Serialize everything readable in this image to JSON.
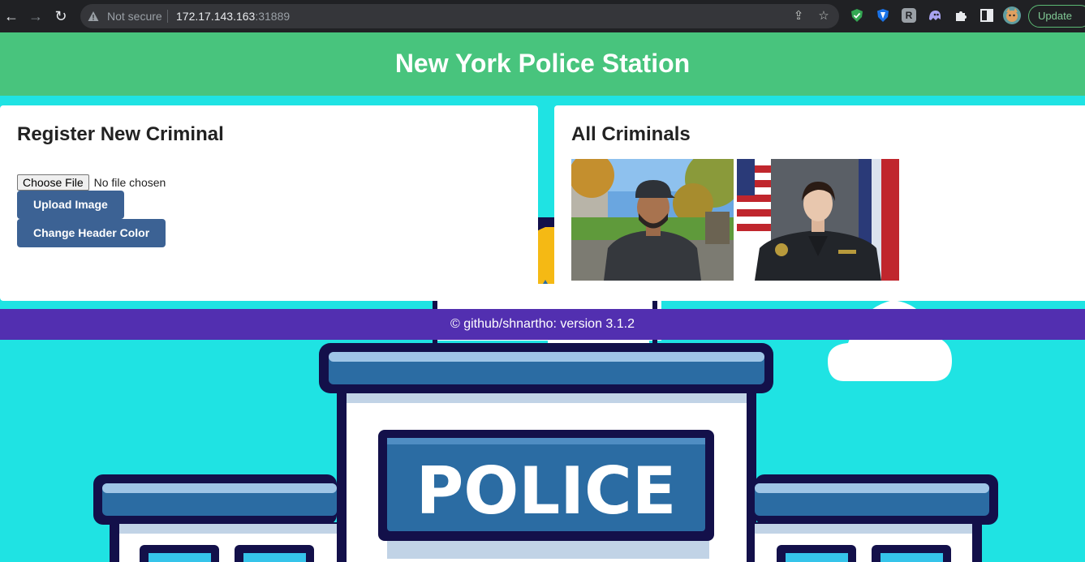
{
  "browser": {
    "security_label": "Not secure",
    "url_host": "172.17.143.163",
    "url_port": ":31889",
    "update_label": "Update",
    "back_glyph": "←",
    "forward_glyph": "→",
    "reload_glyph": "↻",
    "share_glyph": "⇪",
    "bookmark_glyph": "☆",
    "extensions": [
      "shield-extension-icon",
      "password-manager-extension-icon",
      "reader-extension-icon",
      "ghost-extension-icon",
      "puzzle-extensions-icon",
      "side-panel-icon",
      "profile-avatar-icon"
    ]
  },
  "header": {
    "title": "New York Police Station",
    "color": "#48c47d"
  },
  "register": {
    "title": "Register New Criminal",
    "choose_file_label": "Choose File",
    "no_file_label": "No file chosen",
    "upload_label": "Upload Image",
    "change_color_label": "Change Header Color",
    "button_color": "#3c6294"
  },
  "criminals": {
    "title": "All Criminals",
    "images": [
      "man-in-cap-outdoors-photo",
      "police-officer-with-flags-photo"
    ]
  },
  "footer": {
    "text": "© github/shnartho: version 3.1.2",
    "color": "#522fb0"
  },
  "background": {
    "sign_text": "POLICE",
    "color": "#1fe3e3"
  }
}
